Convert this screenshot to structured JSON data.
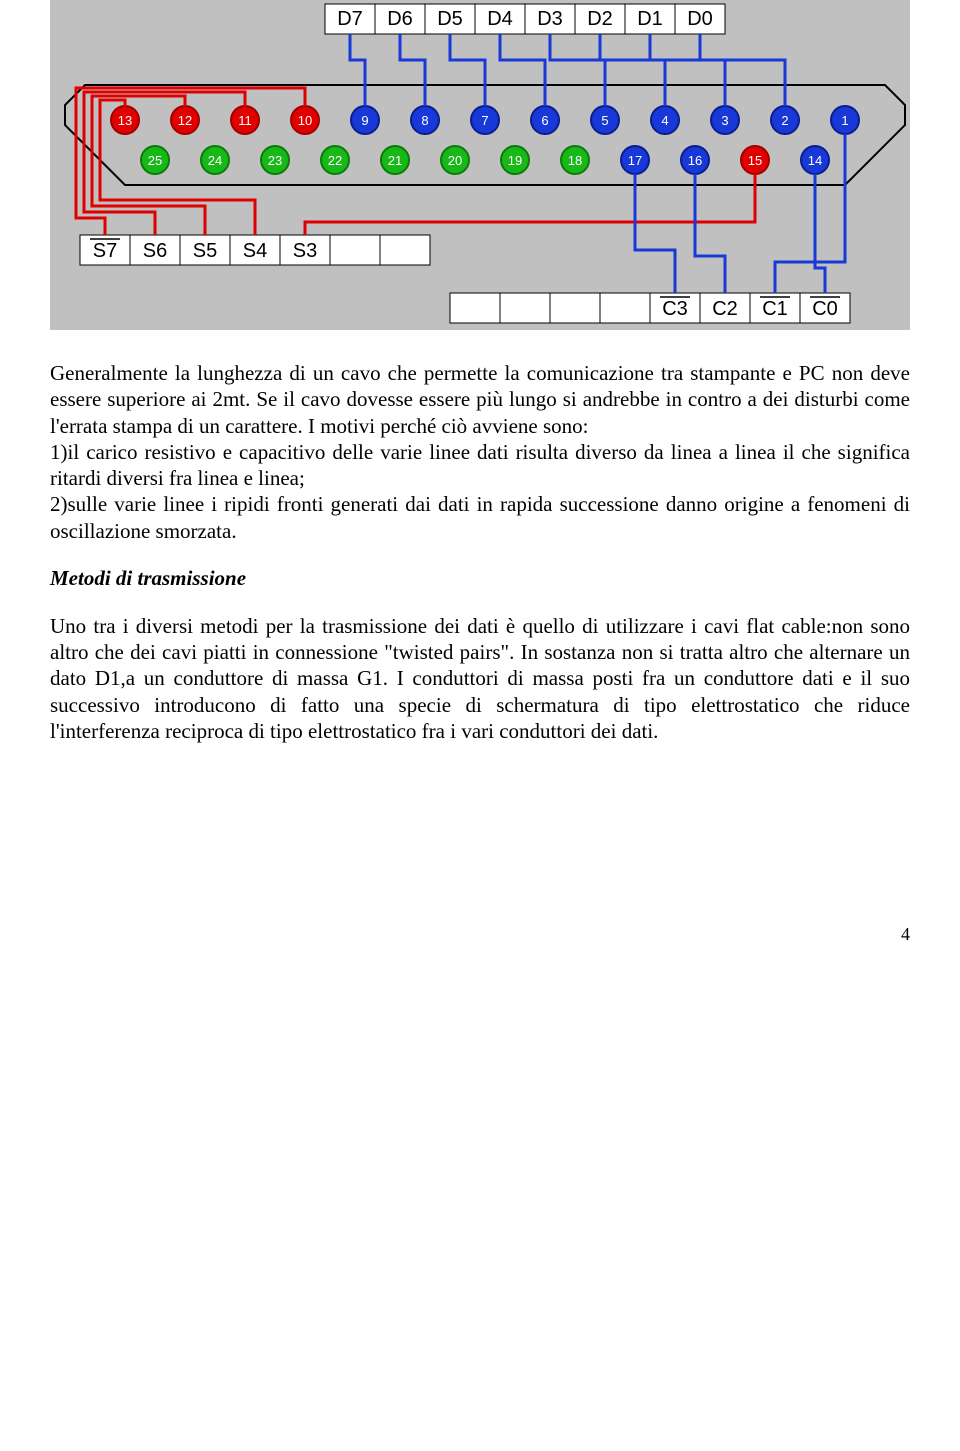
{
  "diagram": {
    "top_labels": [
      "D7",
      "D6",
      "D5",
      "D4",
      "D3",
      "D2",
      "D1",
      "D0"
    ],
    "pins_upper": [
      {
        "n": "13",
        "color": "red"
      },
      {
        "n": "12",
        "color": "red"
      },
      {
        "n": "11",
        "color": "red"
      },
      {
        "n": "10",
        "color": "red"
      },
      {
        "n": "9",
        "color": "blue"
      },
      {
        "n": "8",
        "color": "blue"
      },
      {
        "n": "7",
        "color": "blue"
      },
      {
        "n": "6",
        "color": "blue"
      },
      {
        "n": "5",
        "color": "blue"
      },
      {
        "n": "4",
        "color": "blue"
      },
      {
        "n": "3",
        "color": "blue"
      },
      {
        "n": "2",
        "color": "blue"
      },
      {
        "n": "1",
        "color": "blue"
      }
    ],
    "pins_lower": [
      {
        "n": "25",
        "color": "green"
      },
      {
        "n": "24",
        "color": "green"
      },
      {
        "n": "23",
        "color": "green"
      },
      {
        "n": "22",
        "color": "green"
      },
      {
        "n": "21",
        "color": "green"
      },
      {
        "n": "20",
        "color": "green"
      },
      {
        "n": "19",
        "color": "green"
      },
      {
        "n": "18",
        "color": "green"
      },
      {
        "n": "17",
        "color": "blue"
      },
      {
        "n": "16",
        "color": "blue"
      },
      {
        "n": "15",
        "color": "red"
      },
      {
        "n": "14",
        "color": "blue"
      }
    ],
    "left_labels": [
      {
        "t": "S7",
        "bar": true
      },
      {
        "t": "S6",
        "bar": false
      },
      {
        "t": "S5",
        "bar": false
      },
      {
        "t": "S4",
        "bar": false
      },
      {
        "t": "S3",
        "bar": false
      }
    ],
    "right_labels": [
      {
        "t": "C3",
        "bar": true
      },
      {
        "t": "C2",
        "bar": false
      },
      {
        "t": "C1",
        "bar": true
      },
      {
        "t": "C0",
        "bar": true
      }
    ]
  },
  "para1": "Generalmente la lunghezza di un cavo che permette la comunicazione tra stampante e PC non deve essere superiore ai 2mt. Se il cavo dovesse essere più lungo si andrebbe in contro a dei disturbi come l'errata stampa di un carattere. I motivi perché ciò avviene sono:",
  "li1": "1)il carico resistivo e capacitivo delle varie linee dati risulta diverso da linea a linea il che significa ritardi diversi fra linea e linea;",
  "li2": "2)sulle varie linee i ripidi fronti generati dai dati in rapida successione danno origine a fenomeni di oscillazione smorzata.",
  "heading": "Metodi di trasmissione",
  "para2": "Uno tra i diversi metodi per la trasmissione dei dati è quello di utilizzare i cavi flat cable:non sono altro che dei cavi piatti in connessione \"twisted pairs\". In sostanza non si tratta altro che alternare un dato D1,a un conduttore di massa G1. I conduttori di massa posti fra un conduttore dati e il suo successivo introducono di fatto una specie di schermatura di tipo elettrostatico che riduce l'interferenza reciproca di tipo elettrostatico fra i vari conduttori dei dati.",
  "page_number": "4"
}
